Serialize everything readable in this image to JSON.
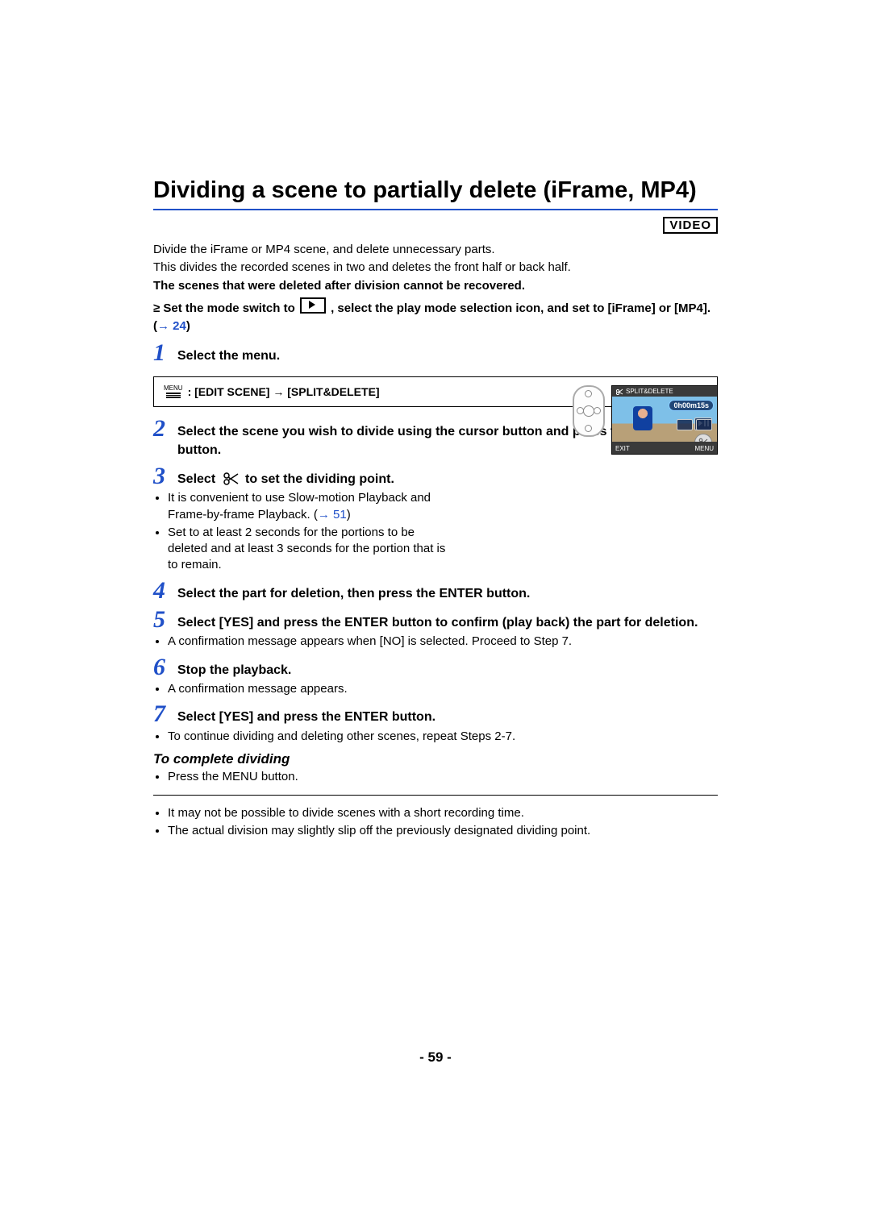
{
  "title": "Dividing a scene to partially delete (iFrame, MP4)",
  "badge": "VIDEO",
  "intro": {
    "l1": "Divide the iFrame or MP4 scene, and delete unnecessary parts.",
    "l2": "This divides the recorded scenes in two and deletes the front half or back half.",
    "l3": "The scenes that were deleted after division cannot be recovered."
  },
  "mode_prefix": "≥ Set the mode switch to ",
  "mode_middle": " , select the play mode selection icon, and set to [iFrame] or [MP4]. (",
  "mode_link_arrow": "→ ",
  "mode_link": "24",
  "mode_close": ")",
  "steps": {
    "n1": "1",
    "h1": "Select the menu.",
    "n2": "2",
    "h2": "Select the scene you wish to divide using the cursor button and press the ENTER button.",
    "n3": "3",
    "h3a": "Select ",
    "h3b": " to set the dividing point.",
    "n4": "4",
    "h4": "Select the part for deletion, then press the ENTER button.",
    "n5": "5",
    "h5": "Select [YES] and press the ENTER button to confirm (play back) the part for deletion.",
    "n6": "6",
    "h6": "Stop the playback.",
    "n7": "7",
    "h7": "Select [YES] and press the ENTER button."
  },
  "menu_label": "MENU",
  "menu_path": ": [EDIT SCENE] → [SPLIT&DELETE]",
  "b3a_pre": "It is convenient to use Slow-motion Playback and Frame-by-frame Playback. (",
  "b3a_link": "51",
  "b3a_post": ")",
  "b3b": "Set to at least 2 seconds for the portions to be deleted and at least 3 seconds for the portion that is to remain.",
  "b5a": "A confirmation message appears when [NO] is selected. Proceed to Step 7.",
  "b6a": "A confirmation message appears.",
  "b7a": "To continue dividing and deleting other scenes, repeat Steps 2-7.",
  "subhead": "To complete dividing",
  "sub_b1": "Press the MENU button.",
  "notes": {
    "n1": "It may not be possible to divide scenes with a short recording time.",
    "n2": "The actual division may slightly slip off the previously designated dividing point."
  },
  "screen": {
    "top_label": "SPLIT&DELETE",
    "time": "0h00m15s",
    "exit": "EXIT",
    "menu": "MENU"
  },
  "page_num": "- 59 -"
}
